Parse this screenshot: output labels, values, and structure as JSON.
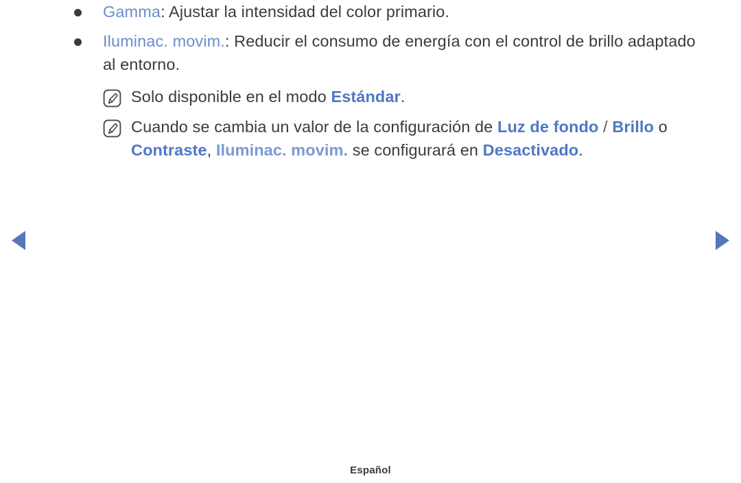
{
  "page": {
    "language_footer": "Español",
    "accent_blue": "#6b8ccc",
    "accent_blue_bold": "#4f77c4",
    "text_color": "#3b3b3b",
    "background": "#ffffff"
  },
  "bullets": [
    {
      "icon": "bullet-dot",
      "term": "Gamma",
      "after_term": ": Ajustar la intensidad del color primario."
    },
    {
      "icon": "bullet-dot",
      "term": "Iluminac. movim.",
      "after_term": ": Reducir el consumo de energía con el control de brillo adaptado al entorno."
    }
  ],
  "notes": [
    {
      "icon": "note-pencil-icon",
      "segments": [
        {
          "text": "Solo disponible en el modo ",
          "style": "plain"
        },
        {
          "text": "Estándar",
          "style": "bold-blue"
        },
        {
          "text": ".",
          "style": "plain"
        }
      ]
    },
    {
      "icon": "note-pencil-icon",
      "segments": [
        {
          "text": "Cuando se cambia un valor de la configuración de ",
          "style": "plain"
        },
        {
          "text": "Luz de fondo",
          "style": "bold-blue"
        },
        {
          "text": " / ",
          "style": "separator"
        },
        {
          "text": "Brillo",
          "style": "bold-blue"
        },
        {
          "text": " o ",
          "style": "plain"
        },
        {
          "text": "Contraste",
          "style": "bold-blue"
        },
        {
          "text": ", ",
          "style": "plain"
        },
        {
          "text": "Iluminac. movim.",
          "style": "light-blue"
        },
        {
          "text": " se configurará en ",
          "style": "plain"
        },
        {
          "text": "Desactivado",
          "style": "bold-blue"
        },
        {
          "text": ".",
          "style": "plain"
        }
      ]
    }
  ],
  "navigation": {
    "prev_label": "◀",
    "next_label": "▶",
    "prev_icon": "triangle-left-icon",
    "next_icon": "triangle-right-icon",
    "arrow_color": "#5577bb"
  }
}
